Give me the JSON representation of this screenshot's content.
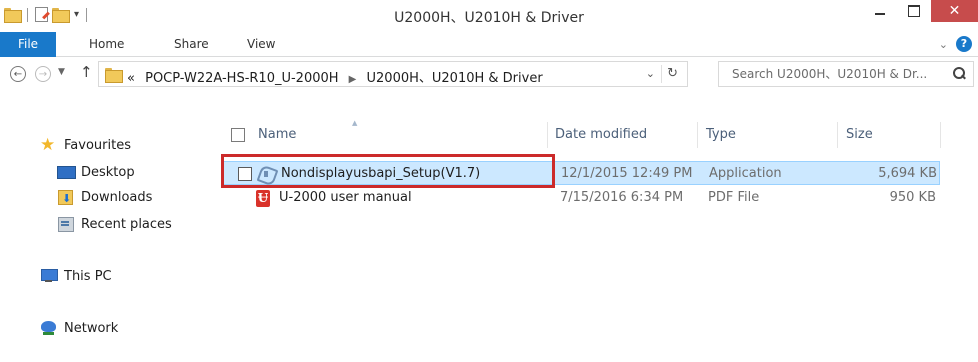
{
  "window": {
    "title": "U2000H、U2010H & Driver",
    "close_glyph": "✕"
  },
  "ribbon": {
    "tabs": [
      "File",
      "Home",
      "Share",
      "View"
    ],
    "help_glyph": "?"
  },
  "address_bar": {
    "overflow_glyph": "«",
    "crumbs": [
      "POCP-W22A-HS-R10_U-2000H",
      "U2000H、U2010H & Driver"
    ]
  },
  "search": {
    "placeholder": "Search U2000H、U2010H & Dr..."
  },
  "nav_pane": {
    "favourites": "Favourites",
    "items": [
      "Desktop",
      "Downloads",
      "Recent places"
    ],
    "this_pc": "This PC",
    "network": "Network"
  },
  "columns": {
    "name": "Name",
    "date_modified": "Date modified",
    "type": "Type",
    "size": "Size"
  },
  "files": [
    {
      "name": "Nondisplayusbapi_Setup(V1.7)",
      "date": "12/1/2015 12:49 PM",
      "type": "Application",
      "size": "5,694 KB",
      "icon": "application-icon",
      "selected": true
    },
    {
      "name": "U-2000 user manual",
      "date": "7/15/2016 6:34 PM",
      "type": "PDF File",
      "size": "950 KB",
      "icon": "pdf-icon",
      "selected": false
    }
  ],
  "colors": {
    "accent": "#1979ca",
    "selection": "#cce8ff",
    "highlight_box": "#cc2a2a",
    "close_button": "#c74c4c"
  }
}
